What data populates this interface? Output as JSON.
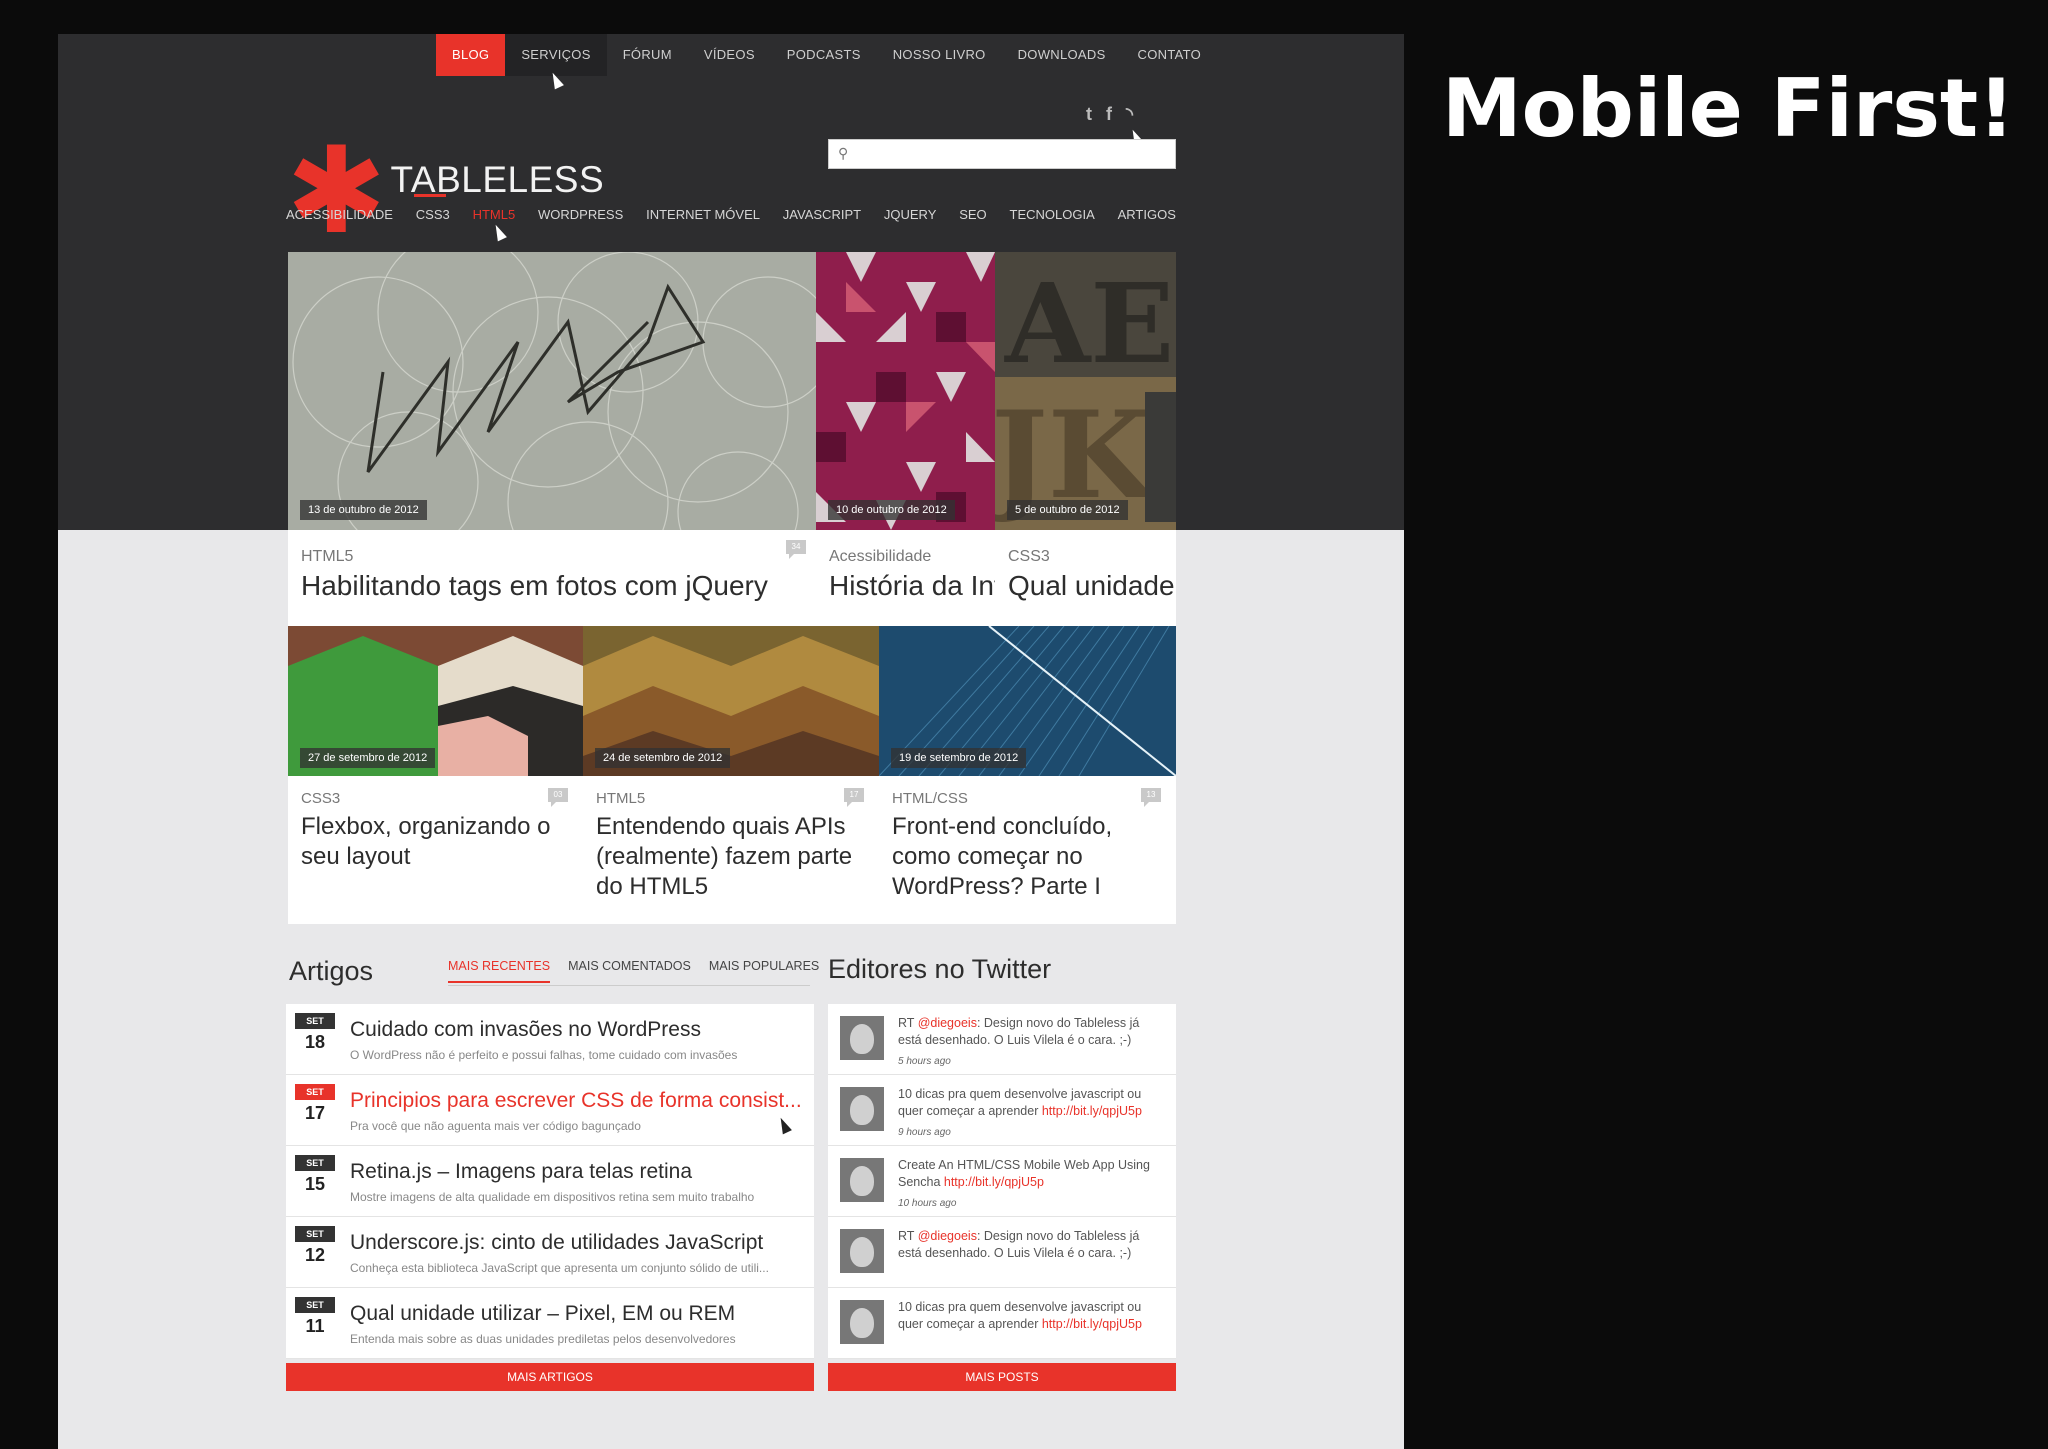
{
  "slide": {
    "title": "Mobile First!"
  },
  "topnav": [
    "BLOG",
    "SERVIÇOS",
    "FÓRUM",
    "VÍDEOS",
    "PODCASTS",
    "NOSSO LIVRO",
    "DOWNLOADS",
    "CONTATO"
  ],
  "logo": {
    "name": "TABLELESS"
  },
  "social": [
    "twitter-icon",
    "facebook-icon",
    "rss-icon"
  ],
  "search": {
    "placeholder": ""
  },
  "catnav": [
    "ACESSIBILIDADE",
    "CSS3",
    "HTML5",
    "WORDPRESS",
    "INTERNET MÓVEL",
    "JAVASCRIPT",
    "JQUERY",
    "SEO",
    "TECNOLOGIA",
    "ARTIGOS"
  ],
  "featured": [
    {
      "date": "13 de outubro de 2012",
      "category": "HTML5",
      "title": "Habilitando tags em fotos com jQuery",
      "comments": "34"
    },
    {
      "date": "10 de outubro de 2012",
      "category": "Acessibilidade",
      "title": "História da Internet"
    },
    {
      "date": "5 de outubro de 2012",
      "category": "CSS3",
      "title": "Qual unidade utilizar"
    },
    {
      "date": "27 de setembro de 2012",
      "category": "CSS3",
      "title": "Flexbox, organizando o seu layout",
      "comments": "03"
    },
    {
      "date": "24 de setembro de 2012",
      "category": "HTML5",
      "title": "Entendendo quais APIs (realmente) fazem parte do HTML5",
      "comments": "17"
    },
    {
      "date": "19 de setembro de 2012",
      "category": "HTML/CSS",
      "title": "Front-end concluído, como começar no WordPress? Parte I",
      "comments": "13"
    }
  ],
  "articles": {
    "heading": "Artigos",
    "tabs": [
      "MAIS RECENTES",
      "MAIS COMENTADOS",
      "MAIS POPULARES"
    ],
    "items": [
      {
        "month": "SET",
        "day": "18",
        "title": "Cuidado com invasões no WordPress",
        "summary": "O WordPress não é perfeito e possui falhas, tome cuidado com invasões"
      },
      {
        "month": "SET",
        "day": "17",
        "title": "Principios para escrever CSS de forma consist...",
        "summary": "Pra você que não aguenta mais ver código bagunçado"
      },
      {
        "month": "SET",
        "day": "15",
        "title": "Retina.js – Imagens para telas retina",
        "summary": "Mostre imagens de alta qualidade em dispositivos retina sem muito trabalho"
      },
      {
        "month": "SET",
        "day": "12",
        "title": "Underscore.js: cinto de utilidades JavaScript",
        "summary": "Conheça esta biblioteca JavaScript que apresenta um conjunto sólido de utili..."
      },
      {
        "month": "SET",
        "day": "11",
        "title": "Qual unidade utilizar – Pixel, EM ou REM",
        "summary": "Entenda mais sobre as duas unidades prediletas pelos desenvolvedores"
      }
    ],
    "more": "MAIS ARTIGOS"
  },
  "twitter": {
    "heading": "Editores no Twitter",
    "items": [
      {
        "pre": "RT ",
        "link": "@diegoeis",
        "text": ": Design novo do Tableless já está desenhado. O Luis Vilela é o cara. ;-)",
        "ago": "5 hours ago"
      },
      {
        "pre": "",
        "text": "10 dicas pra quem desenvolve javascript ou quer começar a aprender ",
        "link": "http://bit.ly/qpjU5p",
        "ago": "9 hours ago"
      },
      {
        "pre": "",
        "text": "Create An HTML/CSS Mobile Web App Using Sencha ",
        "link": "http://bit.ly/qpjU5p",
        "ago": "10 hours ago"
      },
      {
        "pre": "RT ",
        "link": "@diegoeis",
        "text": ": Design novo do Tableless já está desenhado. O Luis Vilela é o cara. ;-)",
        "ago": ""
      },
      {
        "pre": "",
        "text": "10 dicas pra quem desenvolve javascript ou quer começar a aprender ",
        "link": "http://bit.ly/qpjU5p",
        "ago": ""
      }
    ],
    "more": "MAIS POSTS"
  },
  "colors": {
    "accent": "#e8332a",
    "dark": "#2d2d2f"
  }
}
